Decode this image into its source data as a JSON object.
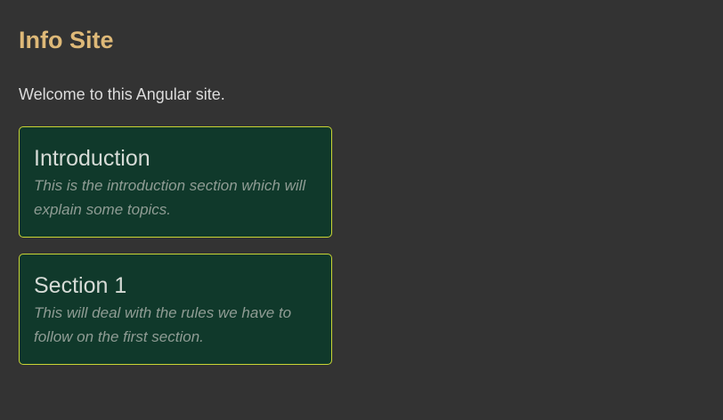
{
  "header": {
    "title": "Info Site"
  },
  "main": {
    "welcome": "Welcome to this Angular site.",
    "cards": [
      {
        "title": "Introduction",
        "description": "This is the introduction section which will explain some topics."
      },
      {
        "title": "Section 1",
        "description": "This will deal with the rules we have to follow on the first section."
      }
    ]
  },
  "colors": {
    "background": "#333333",
    "title": "#deb978",
    "card_background": "#10392b",
    "card_border": "#c9d534"
  }
}
